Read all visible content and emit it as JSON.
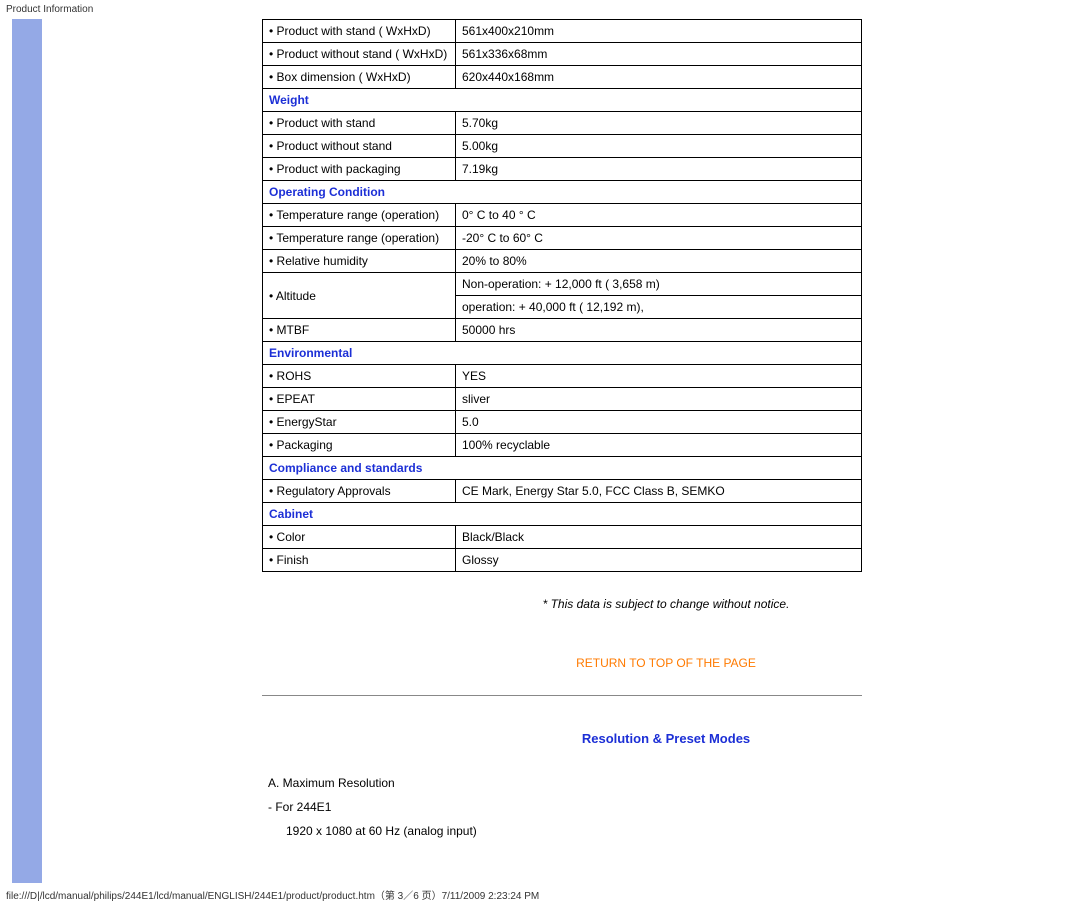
{
  "page": {
    "title": "Product Information",
    "footer": "file:///D|/lcd/manual/philips/244E1/lcd/manual/ENGLISH/244E1/product/product.htm（第 3／6 页）7/11/2009 2:23:24 PM"
  },
  "sections": {
    "dimensions": {
      "rows": [
        {
          "label": "• Product with stand ( WxHxD)",
          "value": "561x400x210mm"
        },
        {
          "label": "• Product without stand ( WxHxD)",
          "value": "561x336x68mm"
        },
        {
          "label": "• Box dimension ( WxHxD)",
          "value": "620x440x168mm"
        }
      ]
    },
    "weight": {
      "header": "Weight",
      "rows": [
        {
          "label": "• Product with stand",
          "value": "5.70kg"
        },
        {
          "label": "• Product without stand",
          "value": "5.00kg"
        },
        {
          "label": "• Product with packaging",
          "value": "7.19kg"
        }
      ]
    },
    "operating": {
      "header": "Operating Condition",
      "rows": [
        {
          "label": "• Temperature range (operation)",
          "value": "0° C to 40 ° C"
        },
        {
          "label": "• Temperature range (operation)",
          "value": "-20° C to 60° C"
        },
        {
          "label": "• Relative humidity",
          "value": "20% to 80%"
        }
      ],
      "altitude": {
        "label": "• Altitude",
        "value1": "Non-operation: + 12,000 ft ( 3,658 m)",
        "value2": "operation: + 40,000 ft ( 12,192 m),"
      },
      "mtbf": {
        "label": "• MTBF",
        "value": "50000 hrs"
      }
    },
    "environmental": {
      "header": "Environmental",
      "rows": [
        {
          "label": "• ROHS",
          "value": "YES"
        },
        {
          "label": "• EPEAT",
          "value": "sliver"
        },
        {
          "label": "• EnergyStar",
          "value": "5.0"
        },
        {
          "label": "• Packaging",
          "value": "100% recyclable"
        }
      ]
    },
    "compliance": {
      "header": "Compliance and standards",
      "rows": [
        {
          "label": "• Regulatory Approvals",
          "value": "CE Mark, Energy Star 5.0, FCC Class B, SEMKO"
        }
      ]
    },
    "cabinet": {
      "header": "Cabinet",
      "rows": [
        {
          "label": "• Color",
          "value": "Black/Black"
        },
        {
          "label": "• Finish",
          "value": "Glossy"
        }
      ]
    }
  },
  "note": "* This data is subject to change without notice.",
  "returnLink": "RETURN TO TOP OF THE PAGE",
  "resolution": {
    "title": "Resolution & Preset Modes",
    "lineA": "A.   Maximum Resolution",
    "lineFor": "-     For 244E1",
    "lineDetail": "1920 x 1080 at 60 Hz (analog input)"
  }
}
